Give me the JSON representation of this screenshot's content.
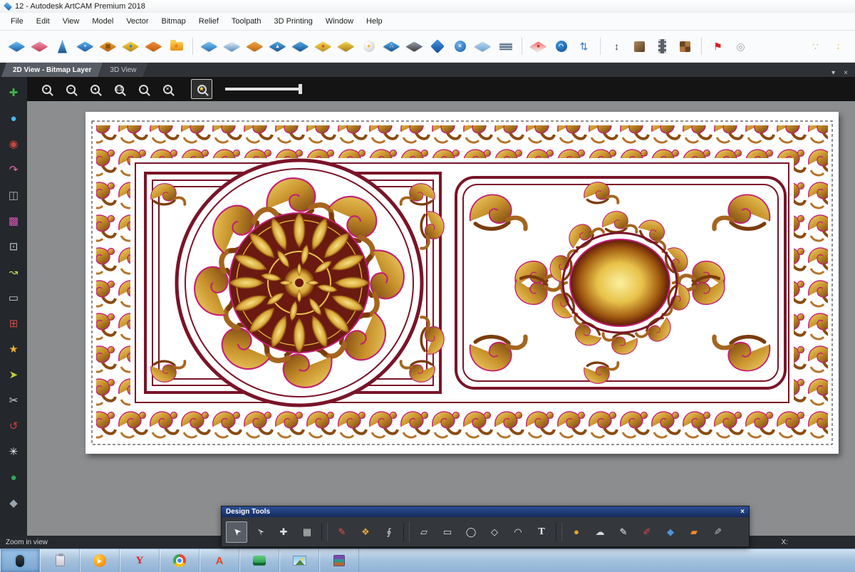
{
  "window": {
    "title": "12 - Autodesk ArtCAM Premium 2018"
  },
  "menu": {
    "items": [
      {
        "name": "menu-file",
        "label": "File"
      },
      {
        "name": "menu-edit",
        "label": "Edit"
      },
      {
        "name": "menu-view",
        "label": "View"
      },
      {
        "name": "menu-model",
        "label": "Model"
      },
      {
        "name": "menu-vector",
        "label": "Vector"
      },
      {
        "name": "menu-bitmap",
        "label": "Bitmap"
      },
      {
        "name": "menu-relief",
        "label": "Relief"
      },
      {
        "name": "menu-toolpath",
        "label": "Toolpath"
      },
      {
        "name": "menu-3d-printing",
        "label": "3D Printing"
      },
      {
        "name": "menu-window",
        "label": "Window"
      },
      {
        "name": "menu-help",
        "label": "Help"
      }
    ]
  },
  "toolbar": {
    "items": [
      {
        "name": "new-model-icon",
        "cls": "tico dm",
        "c1": "#6cc0f4",
        "c2": "#1a5fae"
      },
      {
        "name": "erase-relief-icon",
        "cls": "tico dm",
        "c1": "#f498b0",
        "c2": "#c23a58"
      },
      {
        "name": "smooth-relief-icon",
        "cls": "tico shard",
        "c1": "#6cc0f4",
        "c2": "#14508e"
      },
      {
        "name": "two-rail-sweep-icon",
        "cls": "tico dm",
        "c1": "#5ab2ec",
        "c2": "#1e5ca6",
        "glyph": "∘",
        "gc": "#e8f2fa"
      },
      {
        "name": "weave-wizard-icon",
        "cls": "tico dm",
        "c1": "#f6b040",
        "c2": "#b45c08",
        "glyph": "▦",
        "gc": "#8a4a08"
      },
      {
        "name": "face-wizard-icon",
        "cls": "tico dm",
        "c1": "#f6d84c",
        "c2": "#b8860c",
        "glyph": "●",
        "gc": "#3878c0"
      },
      {
        "name": "extrude-icon",
        "cls": "tico dm",
        "c1": "#f49038",
        "c2": "#c05c08"
      },
      {
        "name": "import-clipart-icon",
        "cls": "tico folder",
        "c1": "#f8cc48",
        "c2": "#e89018",
        "glyph": "★",
        "gc": "#f07818"
      },
      {
        "name": "separator",
        "wcls": "tbtn sepw",
        "cls": "tico vsep"
      },
      {
        "name": "flat-plane-icon",
        "cls": "tico dm",
        "c1": "#7ccaf6",
        "c2": "#2a6cb6"
      },
      {
        "name": "mirror-relief-icon",
        "cls": "tico dm",
        "c1": "#eef4fa",
        "c2": "#5088c0"
      },
      {
        "name": "offset-relief-icon",
        "cls": "tico dm",
        "c1": "#f6a844",
        "c2": "#b86410"
      },
      {
        "name": "raise-relief-icon",
        "cls": "tico dm",
        "c1": "#54aae8",
        "c2": "#16548e",
        "glyph": "▴",
        "gc": "#e8f2fa"
      },
      {
        "name": "ring-relief-icon",
        "cls": "tico dm",
        "c1": "#54aae8",
        "c2": "#16548e",
        "glyph": "◦",
        "gc": "#c08ce0"
      },
      {
        "name": "droplet-relief-icon",
        "cls": "tico dm",
        "c1": "#f6d84c",
        "c2": "#c09018",
        "glyph": "●",
        "gc": "#d83838"
      },
      {
        "name": "gold-relief-icon",
        "cls": "tico dm",
        "c1": "#f6d84c",
        "c2": "#a87c10"
      },
      {
        "name": "light-source-icon",
        "cls": "tico sp",
        "c1": "#ffffff",
        "c2": "#c8c8c8",
        "glyph": "●",
        "gc": "#f0b818"
      },
      {
        "name": "texture-relief-icon",
        "cls": "tico dm",
        "c1": "#54aae8",
        "c2": "#16548e",
        "glyph": "∴",
        "gc": "#e8f2fa"
      },
      {
        "name": "dark-layers-icon",
        "cls": "tico dm",
        "c1": "#9aa2aa",
        "c2": "#383c40"
      },
      {
        "name": "blue-plane-icon",
        "cls": "tico dm2",
        "c1": "#4898e4",
        "c2": "#0e4898"
      },
      {
        "name": "sphere-erase-icon",
        "cls": "tico sp",
        "c1": "#6cb4ee",
        "c2": "#1e5ca6",
        "glyph": "×",
        "gc": "#ffffff"
      },
      {
        "name": "pale-plane-icon",
        "cls": "tico dm",
        "c1": "#c2dcf2",
        "c2": "#6aa0cc"
      },
      {
        "name": "layer-stack-icon",
        "cls": "tico layers",
        "c1": "#c8d2da",
        "c2": "#5a7288"
      },
      {
        "name": "separator",
        "wcls": "tbtn sepw",
        "cls": "tico vsep"
      },
      {
        "name": "color-droplet-icon",
        "cls": "tico dm",
        "c1": "#ee6868",
        "c2": "#f8f0ee",
        "glyph": "●",
        "gc": "#c03030"
      },
      {
        "name": "sphere-ring-icon",
        "cls": "tico sp",
        "c1": "#3e96e0",
        "c2": "#0e4c96",
        "glyph": "◠",
        "gc": "#ffffff"
      },
      {
        "name": "sort-layers-icon",
        "cls": "tico none",
        "glyph": "⇅",
        "gc": "#3878c8",
        "gcl": "tg lg"
      },
      {
        "name": "separator",
        "wcls": "tbtn sepw",
        "cls": "tico vsep"
      },
      {
        "name": "measure-height-icon",
        "cls": "tico none",
        "glyph": "↕",
        "gc": "#404040",
        "gcl": "tg lg"
      },
      {
        "name": "material-swatch-icon",
        "cls": "tico sq",
        "c1": "#b08a62",
        "c2": "#5c3a1e"
      },
      {
        "name": "filmstrip-icon",
        "cls": "tico film",
        "c1": "#c8ccd4",
        "c2": "#585e66"
      },
      {
        "name": "swatch-grid-icon",
        "cls": "tico grid",
        "c1": "#b07840",
        "c2": "#6a4422"
      },
      {
        "name": "separator",
        "wcls": "tbtn sepw",
        "cls": "tico vsep"
      },
      {
        "name": "toolpath-flag-icon",
        "cls": "tico none",
        "glyph": "⚑",
        "gc": "#d42020",
        "gcl": "tg lg"
      },
      {
        "name": "preview-circle-icon",
        "cls": "tico none",
        "glyph": "◎",
        "gc": "#9aa0a8",
        "gcl": "tg lg"
      },
      {
        "name": "nest-dots-icon",
        "wcls": "tbtn push",
        "cls": "tico none",
        "glyph": "∵",
        "gc": "#e8b818",
        "gcl": "tg lg"
      },
      {
        "name": "dot-pair-icon",
        "cls": "tico none",
        "glyph": "∶",
        "gc": "#e8b818",
        "gcl": "tg lg"
      }
    ]
  },
  "tabstrip": {
    "tabs": [
      {
        "name": "tab-2d-view",
        "label": "2D View - Bitmap Layer",
        "cls": "tab active"
      },
      {
        "name": "tab-3d-view",
        "label": "3D View",
        "cls": "tab"
      }
    ],
    "menu_glyph": "▾",
    "close_glyph": "×"
  },
  "sidebar": {
    "items": [
      {
        "name": "add-relief-icon",
        "glyph": "✚",
        "color": "#3cb54a"
      },
      {
        "name": "sphere-shape-icon",
        "glyph": "●",
        "color": "#48b8ee"
      },
      {
        "name": "texture-circle-icon",
        "glyph": "◉",
        "color": "#cc4444"
      },
      {
        "name": "spline-draw-icon",
        "glyph": "↷",
        "color": "#e868b0"
      },
      {
        "name": "mirror-tool-icon",
        "glyph": "◫",
        "color": "#aab4be"
      },
      {
        "name": "select-region-icon",
        "glyph": "▩",
        "color": "#d653b8"
      },
      {
        "name": "shape-overlay-icon",
        "glyph": "⊡",
        "color": "#c2cad2"
      },
      {
        "name": "freehand-curve-icon",
        "glyph": "↝",
        "color": "#c8d84a"
      },
      {
        "name": "rectangle-shape-icon",
        "glyph": "▭",
        "color": "#ccd2d8"
      },
      {
        "name": "snap-region-icon",
        "glyph": "⊞",
        "color": "#cc4848"
      },
      {
        "name": "clipart-star-icon",
        "glyph": "★",
        "color": "#eeb02c"
      },
      {
        "name": "vector-draw-icon",
        "glyph": "➤",
        "color": "#bed03c"
      },
      {
        "name": "trim-vectors-icon",
        "glyph": "✂",
        "color": "#d4dadf"
      },
      {
        "name": "swirl-curve-icon",
        "glyph": "↺",
        "color": "#cc4040"
      },
      {
        "name": "starburst-icon",
        "glyph": "✳",
        "color": "#eef2f6"
      },
      {
        "name": "green-dome-icon",
        "glyph": "●",
        "color": "#30a858"
      },
      {
        "name": "relief-block-icon",
        "glyph": "◆",
        "color": "#9aa4ae"
      }
    ]
  },
  "zoombar": {
    "buttons": [
      {
        "name": "zoom-in-button",
        "cls": "zbtn",
        "glyph": "+"
      },
      {
        "name": "zoom-out-button",
        "cls": "zbtn",
        "glyph": "−"
      },
      {
        "name": "zoom-previous-button",
        "cls": "zbtn",
        "glyph": "◂"
      },
      {
        "name": "zoom-1to1-button",
        "cls": "zbtn",
        "glyph": "1:1"
      },
      {
        "name": "zoom-window-button",
        "cls": "zbtn",
        "glyph": "▫"
      },
      {
        "name": "zoom-extents-button",
        "cls": "zbtn",
        "glyph": "×"
      },
      {
        "name": "zoom-objects-button",
        "cls": "zbtn active",
        "glyph": "★",
        "gc": "#f5d442"
      }
    ]
  },
  "design_tools": {
    "title": "Design Tools",
    "close_glyph": "×",
    "items": [
      {
        "name": "select-vectors-tool",
        "cls": "dtn active",
        "gcls": "dtg r135",
        "glyph": "➤",
        "color": "#f2f2f2"
      },
      {
        "name": "node-editing-tool",
        "cls": "dtn",
        "gcls": "dtg r135",
        "glyph": "➢",
        "color": "#e6e6e6"
      },
      {
        "name": "transform-vectors-tool",
        "cls": "dtn",
        "glyph": "✚",
        "color": "#e6e6e6"
      },
      {
        "name": "envelope-distort-tool",
        "cls": "dtn",
        "glyph": "▦",
        "color": "#cccccc"
      },
      {
        "name": "separator",
        "cls": "dsep",
        "glyph": ""
      },
      {
        "name": "freehand-draw-tool",
        "cls": "dtn",
        "glyph": "✎",
        "color": "#e65050"
      },
      {
        "name": "shape-editor-tool",
        "cls": "dtn",
        "glyph": "❖",
        "color": "#eca23a"
      },
      {
        "name": "contour-trace-tool",
        "cls": "dtn",
        "glyph": "∮",
        "color": "#dddddd"
      },
      {
        "name": "separator",
        "cls": "dsep",
        "glyph": ""
      },
      {
        "name": "create-polyline-tool",
        "cls": "dtn",
        "glyph": "▱",
        "color": "#e0e0e0"
      },
      {
        "name": "create-rectangle-tool",
        "cls": "dtn",
        "glyph": "▭",
        "color": "#e0e0e0"
      },
      {
        "name": "create-ellipse-tool",
        "cls": "dtn",
        "glyph": "◯",
        "color": "#e0e0e0"
      },
      {
        "name": "create-polygon-tool",
        "cls": "dtn",
        "glyph": "◇",
        "color": "#e0e0e0"
      },
      {
        "name": "create-arc-tool",
        "cls": "dtn",
        "glyph": "◠",
        "color": "#e0e0e0"
      },
      {
        "name": "create-text-tool",
        "cls": "dtn",
        "gcls": "dtg tt",
        "glyph": "T",
        "color": "#f2f2f2"
      },
      {
        "name": "separator",
        "cls": "dsep",
        "glyph": ""
      },
      {
        "name": "fluid-relief-tool",
        "cls": "dtn",
        "glyph": "●",
        "color": "#f2a41e"
      },
      {
        "name": "airbrush-tool",
        "cls": "dtn",
        "glyph": "☁",
        "color": "#d8d8d8"
      },
      {
        "name": "draw-pencil-tool",
        "cls": "dtn",
        "glyph": "✎",
        "color": "#f0f0f0"
      },
      {
        "name": "paint-brush-tool",
        "cls": "dtn",
        "glyph": "✐",
        "color": "#dc4848"
      },
      {
        "name": "smudge-diamond-tool",
        "cls": "dtn",
        "glyph": "◆",
        "color": "#4a96dc"
      },
      {
        "name": "wide-brush-tool",
        "cls": "dtn",
        "glyph": "▰",
        "color": "#ec8c28"
      },
      {
        "name": "fine-pencil-tool",
        "cls": "dtn",
        "gcls": "dtg flip",
        "glyph": "✎",
        "color": "#bdbdbd"
      }
    ]
  },
  "statusbar": {
    "message": "Zoom in view",
    "x_label": "X:"
  },
  "taskbar": {
    "items": [
      {
        "name": "taskbar-pointer-device",
        "wcls": "tk on",
        "cls": "tkg tk-mouse",
        "label": ""
      },
      {
        "name": "taskbar-clipboard",
        "cls": "tkg tk-clip",
        "label": ""
      },
      {
        "name": "taskbar-media-player",
        "cls": "tkg tk-media",
        "label": "▶"
      },
      {
        "name": "taskbar-yandex-browser",
        "cls": "tkg tk-yandex",
        "label": "Y"
      },
      {
        "name": "taskbar-chrome",
        "cls": "tkg tk-chrome",
        "label": ""
      },
      {
        "name": "taskbar-artcam",
        "cls": "tkg tk-artcam",
        "label": "A"
      },
      {
        "name": "taskbar-3d-printing",
        "cls": "tkg tk-print3d",
        "label": ""
      },
      {
        "name": "taskbar-photo-viewer",
        "cls": "tkg tk-photo",
        "label": ""
      },
      {
        "name": "taskbar-winrar",
        "cls": "tkg tk-winrar",
        "label": ""
      }
    ]
  }
}
